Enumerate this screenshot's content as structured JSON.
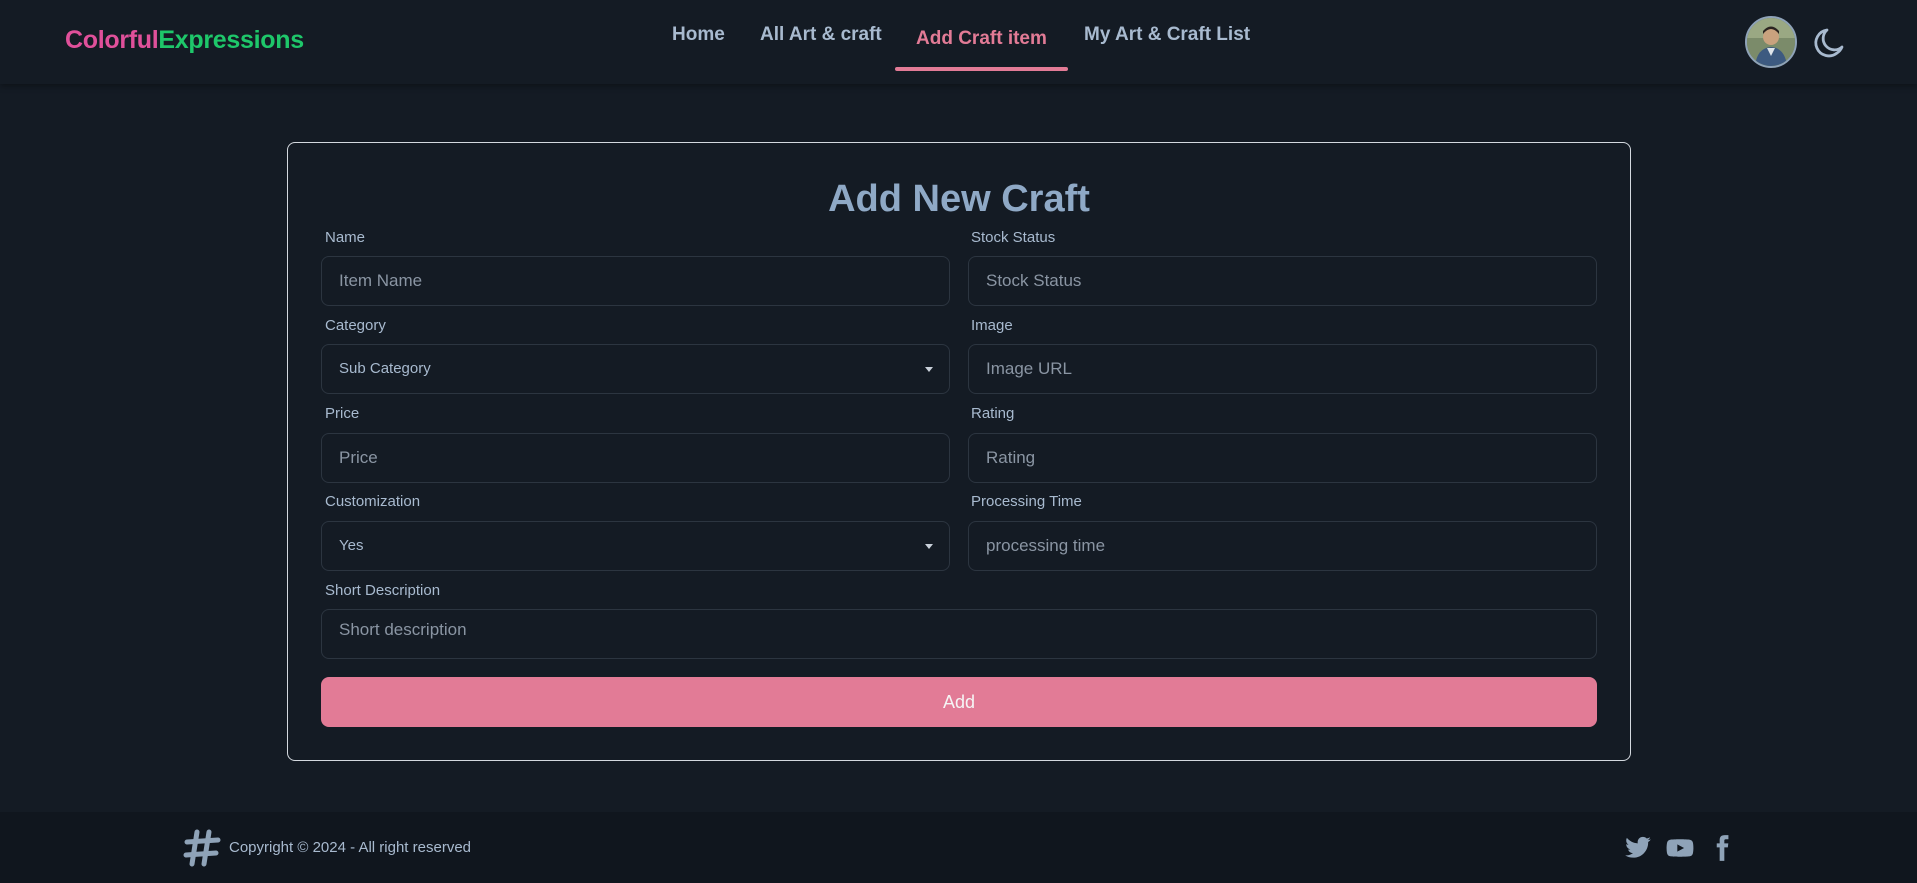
{
  "brand": {
    "part1": "Colorful",
    "part2": "Expressions",
    "color1": "#e0509a",
    "color2": "#1ec76a"
  },
  "nav": {
    "items": [
      {
        "label": "Home"
      },
      {
        "label": "All Art & craft"
      },
      {
        "label": "Add Craft item",
        "active": true
      },
      {
        "label": "My Art & Craft List"
      }
    ],
    "active_color": "#e27b96"
  },
  "header_icons": {
    "avatar": "user-avatar",
    "theme": "moon-icon"
  },
  "form": {
    "title": "Add New Craft",
    "fields": {
      "name": {
        "label": "Name",
        "placeholder": "Item Name"
      },
      "stock_status": {
        "label": "Stock Status",
        "placeholder": "Stock Status"
      },
      "category": {
        "label": "Category",
        "value": "Sub Category"
      },
      "image": {
        "label": "Image",
        "placeholder": "Image URL"
      },
      "price": {
        "label": "Price",
        "placeholder": "Price"
      },
      "rating": {
        "label": "Rating",
        "placeholder": "Rating"
      },
      "customization": {
        "label": "Customization",
        "value": "Yes"
      },
      "processing_time": {
        "label": "Processing Time",
        "placeholder": "processing time"
      },
      "short_description": {
        "label": "Short Description",
        "placeholder": "Short description"
      }
    },
    "submit_label": "Add",
    "accent_color": "#e27b96"
  },
  "footer": {
    "copyright": "Copyright © 2024 - All right reserved",
    "icons": [
      "hashtag-logo-icon",
      "twitter-icon",
      "youtube-icon",
      "facebook-icon"
    ]
  }
}
